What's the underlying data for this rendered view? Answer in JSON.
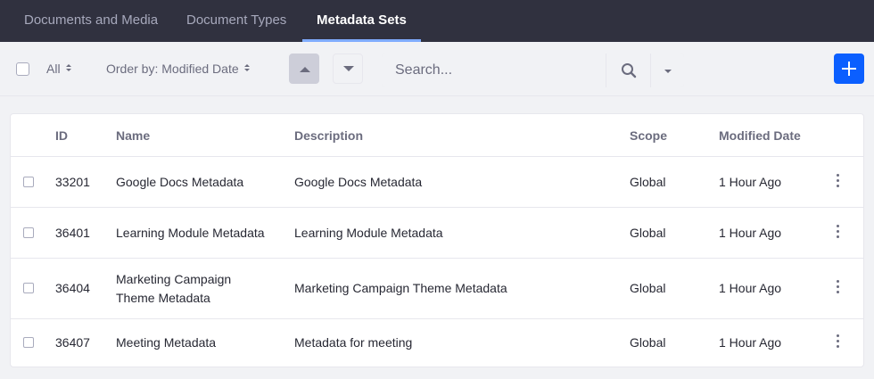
{
  "nav": {
    "tabs": [
      {
        "label": "Documents and Media",
        "active": false
      },
      {
        "label": "Document Types",
        "active": false
      },
      {
        "label": "Metadata Sets",
        "active": true
      }
    ]
  },
  "toolbar": {
    "filter_label": "All",
    "order_label": "Order by: Modified Date",
    "sort_asc_icon": "caret-up-icon",
    "sort_desc_icon": "caret-down-icon",
    "search_placeholder": "Search...",
    "search_value": "",
    "search_icon": "search-icon",
    "add_icon": "plus-icon"
  },
  "table": {
    "columns": [
      "ID",
      "Name",
      "Description",
      "Scope",
      "Modified Date"
    ],
    "rows": [
      {
        "id": "33201",
        "name": "Google Docs Metadata",
        "description": "Google Docs Metadata",
        "scope": "Global",
        "modified": "1 Hour Ago"
      },
      {
        "id": "36401",
        "name": "Learning Module Metadata",
        "description": "Learning Module Metadata",
        "scope": "Global",
        "modified": "1 Hour Ago"
      },
      {
        "id": "36404",
        "name": "Marketing Campaign Theme Metadata",
        "description": "Marketing Campaign Theme Metadata",
        "scope": "Global",
        "modified": "1 Hour Ago"
      },
      {
        "id": "36407",
        "name": "Meeting Metadata",
        "description": "Metadata for meeting",
        "scope": "Global",
        "modified": "1 Hour Ago"
      }
    ]
  },
  "colors": {
    "nav_bg": "#30313f",
    "active_tab_underline": "#80acff",
    "primary": "#0b5fff"
  }
}
